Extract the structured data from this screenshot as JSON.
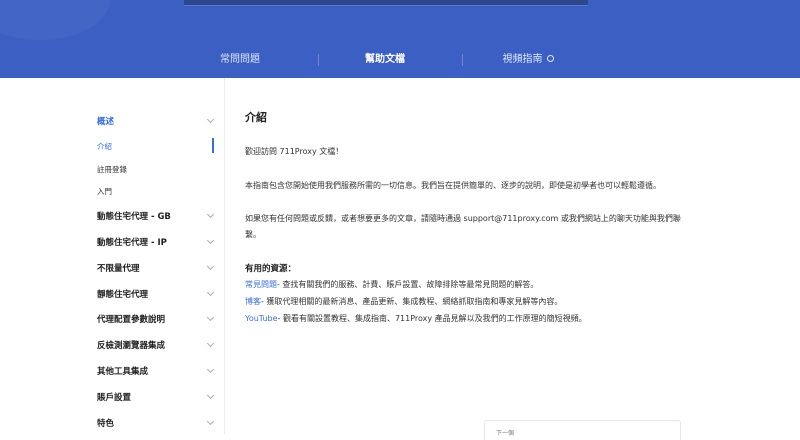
{
  "tabs": [
    {
      "label": "常問問題"
    },
    {
      "label": "幫助文檔"
    },
    {
      "label": "視頻指南"
    }
  ],
  "sidebar": {
    "overview": "概述",
    "sub": [
      "介紹",
      "註冊登錄",
      "入門"
    ],
    "sections": [
      "動態住宅代理 - GB",
      "動態住宅代理 - IP",
      "不限量代理",
      "靜態住宅代理",
      "代理配置參數說明",
      "反檢測瀏覽器集成",
      "其他工具集成",
      "賬戶設置",
      "特色"
    ]
  },
  "content": {
    "title": "介紹",
    "welcome": "歡迎訪問 711Proxy 文檔！",
    "intro": "本指南包含您開始使用我們服務所需的一切信息。我們旨在提供簡單的、逐步的說明，即使是初學者也可以輕鬆遵循。",
    "contact": "如果您有任何問題或反饋，或者想要更多的文章，請隨時通過 support@711proxy.com 或我們網站上的聊天功能與我們聯繫。",
    "resources_title": "有用的資源：",
    "resources": [
      {
        "link": "常見問題",
        "text": "- 查找有關我們的服務、計費、賬戶設置、故障排除等最常見問題的解答。"
      },
      {
        "link": "博客",
        "text": "- 獲取代理相關的最新消息、產品更新、集成教程、網絡抓取指南和專家見解等內容。"
      },
      {
        "link": "YouTube",
        "text": "- 觀看有關設置教程、集成指南、711Proxy 產品見解以及我們的工作原理的簡短視頻。"
      }
    ],
    "next_label": "下一個"
  },
  "colors": {
    "brand": "#3c5fc4",
    "accent": "#3a6fd8"
  }
}
